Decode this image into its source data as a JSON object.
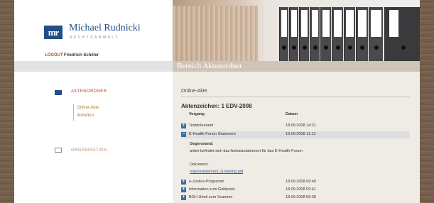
{
  "header": {
    "logo_text": "mr",
    "name": "Michael Rudnicki",
    "subtitle": "RECHTSANWALT",
    "logout_label": "LOGOUT",
    "user_name": "Friedrich Schiller"
  },
  "band_title": "Bereich Aktenordner",
  "sidebar": {
    "items": [
      {
        "label": "AKTENORDNER",
        "active": true,
        "icon": "folder-square-icon"
      },
      {
        "label": "ORGANISATION",
        "active": false,
        "icon": "empty-square-icon"
      }
    ],
    "sub_items": [
      {
        "label": "Online-Akte"
      },
      {
        "label": "Abheften"
      }
    ]
  },
  "main": {
    "section_title": "Online-Akte",
    "akte_title": "Aktenzeichen: 1 EDV-2008",
    "columns": [
      "Vorgang",
      "Datum"
    ],
    "rows": [
      {
        "toggle": "+",
        "title": "Testdokument",
        "date": "18.09.2008 14:21"
      },
      {
        "toggle": "–",
        "title": "E-Health-Forum Statement",
        "date": "18.09.2008 11:13",
        "open": true
      },
      {
        "toggle": "+",
        "title": "e-Justice-Programm",
        "date": "18.09.2008 09:49"
      },
      {
        "toggle": "+",
        "title": "Information zum Goldpreis",
        "date": "18.09.2008 09:41"
      },
      {
        "toggle": "+",
        "title": "BGH Urteil zum Scannen",
        "date": "18.09.2008 09:38"
      }
    ],
    "detail": {
      "subject_label": "Gegenstand:",
      "subject_text": "anbei befindet sich das Aufsatzstatement für das E-Health-Forum",
      "document_label": "Dokument:",
      "document_link": "Impulsstatement_Groening.pdf"
    }
  },
  "colors": {
    "brand_blue": "#234f86",
    "accent_orange": "#b44a2a",
    "background_brown": "#6e5a49"
  }
}
